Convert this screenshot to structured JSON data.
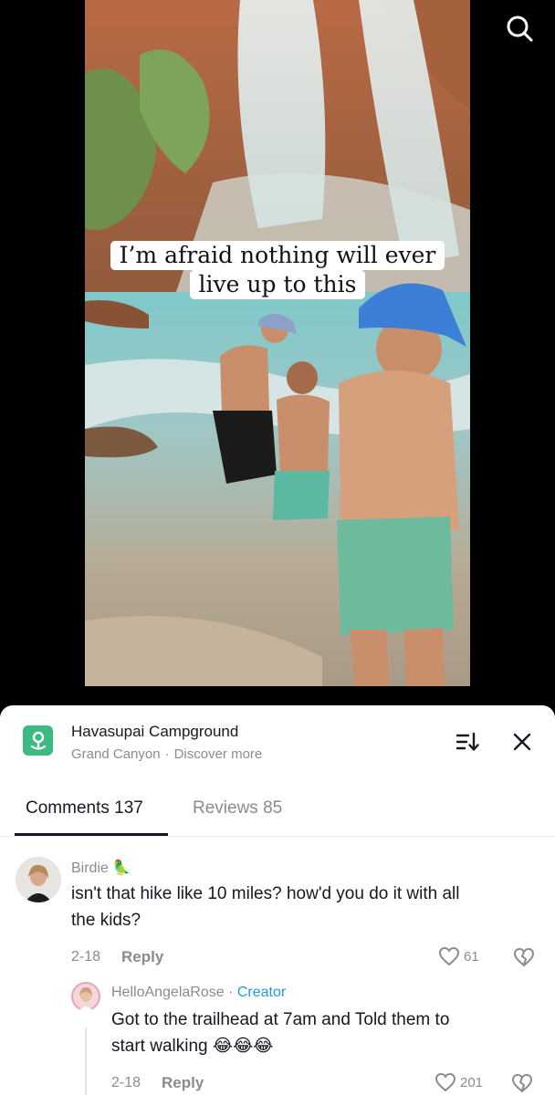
{
  "video": {
    "caption_line1": "I’m afraid nothing will ever",
    "caption_line2": "live up to this"
  },
  "search": {
    "icon": "search-icon"
  },
  "place": {
    "icon": "location-pin-icon",
    "name": "Havasupai Campground",
    "location": "Grand Canyon",
    "separator": "·",
    "discover": "Discover more",
    "accent_color": "#3dba84"
  },
  "header_actions": {
    "sort_icon": "sort-icon",
    "close_icon": "close-icon"
  },
  "tabs": [
    {
      "label": "Comments 137",
      "active": true
    },
    {
      "label": "Reviews 85",
      "active": false
    }
  ],
  "comments": [
    {
      "username": "Birdie 🦜",
      "text_line1": "isn't that hike like 10 miles? how'd you do it with all",
      "text_line2": "the kids?",
      "date": "2-18",
      "reply_label": "Reply",
      "likes": "61",
      "replies": [
        {
          "username": "HelloAngelaRose",
          "separator": "·",
          "badge": "Creator",
          "text_line1": "Got to the trailhead at 7am and Told them to",
          "text_line2": "start walking 😂😂😂",
          "date": "2-18",
          "reply_label": "Reply",
          "likes": "201"
        }
      ]
    }
  ]
}
